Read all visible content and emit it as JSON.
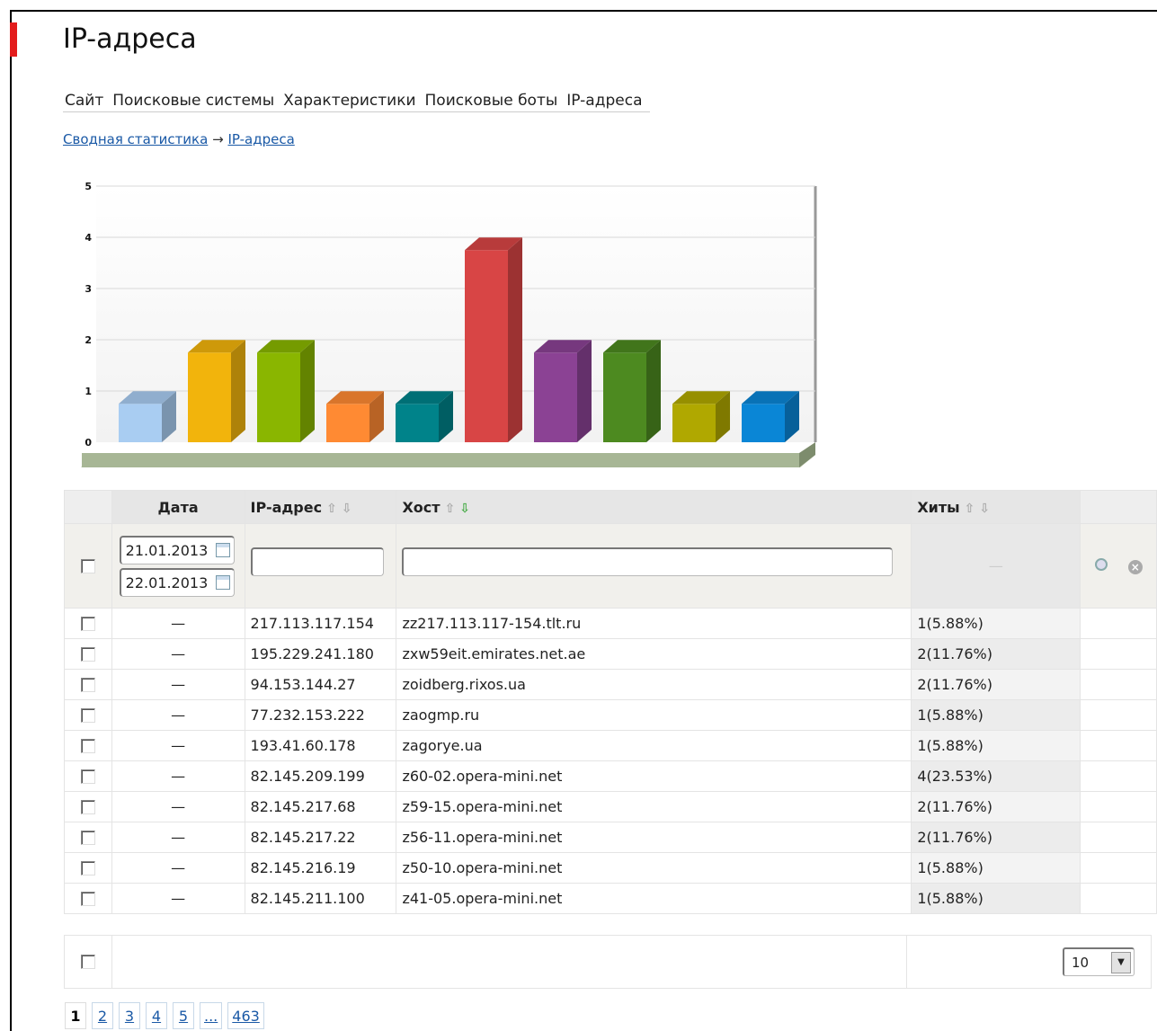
{
  "page": {
    "title": "IP-адреса"
  },
  "tabs": [
    "Сайт",
    "Поисковые системы",
    "Характеристики",
    "Поисковые боты",
    "IP-адреса"
  ],
  "breadcrumb": {
    "root": "Сводная статистика",
    "sep": "→",
    "current": "IP-адреса"
  },
  "chart_data": {
    "type": "bar",
    "categories": [
      "zz217.113.117-154.tlt.ru",
      "zxw59eit.emirates.net.ae",
      "zoidberg.rixos.ua",
      "zaogmp.ru",
      "zagorye.ua",
      "z60-02.opera-mini.net",
      "z59-15.opera-mini.net",
      "z56-11.opera-mini.net",
      "z50-10.opera-mini.net",
      "z41-05.opera-mini.net"
    ],
    "values": [
      1,
      2,
      2,
      1,
      1,
      4,
      2,
      2,
      1,
      1
    ],
    "colors": [
      "#a9cdf2",
      "#f2b40c",
      "#8ab600",
      "#ff8a33",
      "#00838a",
      "#d84545",
      "#8b4294",
      "#4d8a20",
      "#b0a800",
      "#0a86d6"
    ],
    "ylim": [
      0,
      5
    ],
    "yticks": [
      "0",
      "1",
      "2",
      "3",
      "4",
      "5"
    ],
    "grid": true
  },
  "table": {
    "headers": {
      "date": "Дата",
      "ip": "IP-адрес",
      "host": "Хост",
      "hits": "Хиты"
    },
    "sort_up": "⇧",
    "sort_down": "⇩",
    "filter": {
      "date_from": "21.01.2013",
      "date_to": "22.01.2013",
      "ip": "",
      "host": "",
      "hits": "—"
    },
    "rows": [
      {
        "date": "—",
        "ip": "217.113.117.154",
        "host": "zz217.113.117-154.tlt.ru",
        "hits": "1(5.88%)"
      },
      {
        "date": "—",
        "ip": "195.229.241.180",
        "host": "zxw59eit.emirates.net.ae",
        "hits": "2(11.76%)"
      },
      {
        "date": "—",
        "ip": "94.153.144.27",
        "host": "zoidberg.rixos.ua",
        "hits": "2(11.76%)"
      },
      {
        "date": "—",
        "ip": "77.232.153.222",
        "host": "zaogmp.ru",
        "hits": "1(5.88%)"
      },
      {
        "date": "—",
        "ip": "193.41.60.178",
        "host": "zagorye.ua",
        "hits": "1(5.88%)"
      },
      {
        "date": "—",
        "ip": "82.145.209.199",
        "host": "z60-02.opera-mini.net",
        "hits": "4(23.53%)"
      },
      {
        "date": "—",
        "ip": "82.145.217.68",
        "host": "z59-15.opera-mini.net",
        "hits": "2(11.76%)"
      },
      {
        "date": "—",
        "ip": "82.145.217.22",
        "host": "z56-11.opera-mini.net",
        "hits": "2(11.76%)"
      },
      {
        "date": "—",
        "ip": "82.145.216.19",
        "host": "z50-10.opera-mini.net",
        "hits": "1(5.88%)"
      },
      {
        "date": "—",
        "ip": "82.145.211.100",
        "host": "z41-05.opera-mini.net",
        "hits": "1(5.88%)"
      }
    ]
  },
  "footer": {
    "per_page": "10"
  },
  "pager": [
    "1",
    "2",
    "3",
    "4",
    "5",
    "...",
    "463"
  ]
}
